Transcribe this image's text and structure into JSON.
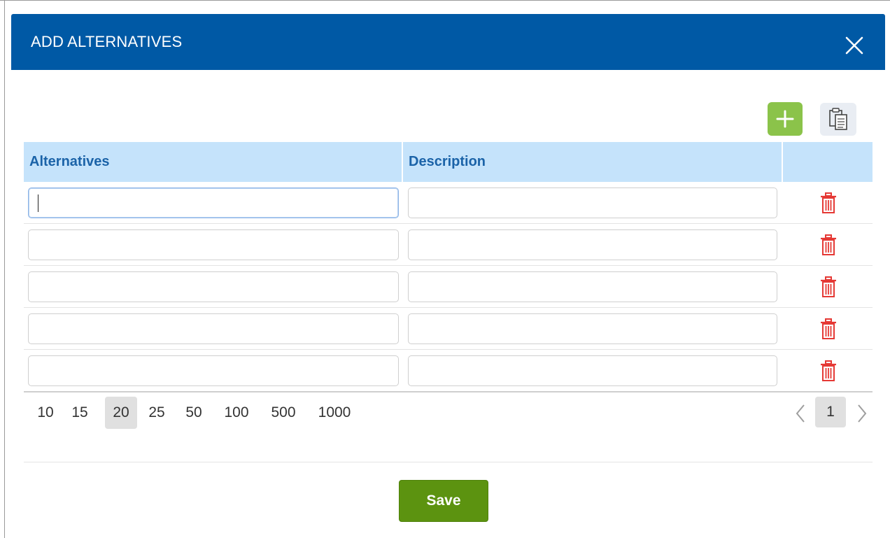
{
  "dialog": {
    "title": "ADD ALTERNATIVES",
    "header_color": "#0059a5"
  },
  "toolbar": {
    "add_icon": "plus-icon",
    "add_color": "#8bc34a",
    "paste_icon": "clipboard-icon"
  },
  "table": {
    "columns": [
      "Alternatives",
      "Description"
    ],
    "header_color": "#c5e3fb",
    "rows": [
      {
        "alternative": "",
        "description": ""
      },
      {
        "alternative": "",
        "description": ""
      },
      {
        "alternative": "",
        "description": ""
      },
      {
        "alternative": "",
        "description": ""
      },
      {
        "alternative": "",
        "description": ""
      }
    ],
    "delete_icon": "trash-icon",
    "delete_color": "#e53935"
  },
  "pager": {
    "page_sizes": [
      "10",
      "15",
      "20",
      "25",
      "50",
      "100",
      "500",
      "1000"
    ],
    "selected_page_size": "20",
    "current_page": "1"
  },
  "footer": {
    "save_label": "Save",
    "save_color": "#5c9310"
  }
}
